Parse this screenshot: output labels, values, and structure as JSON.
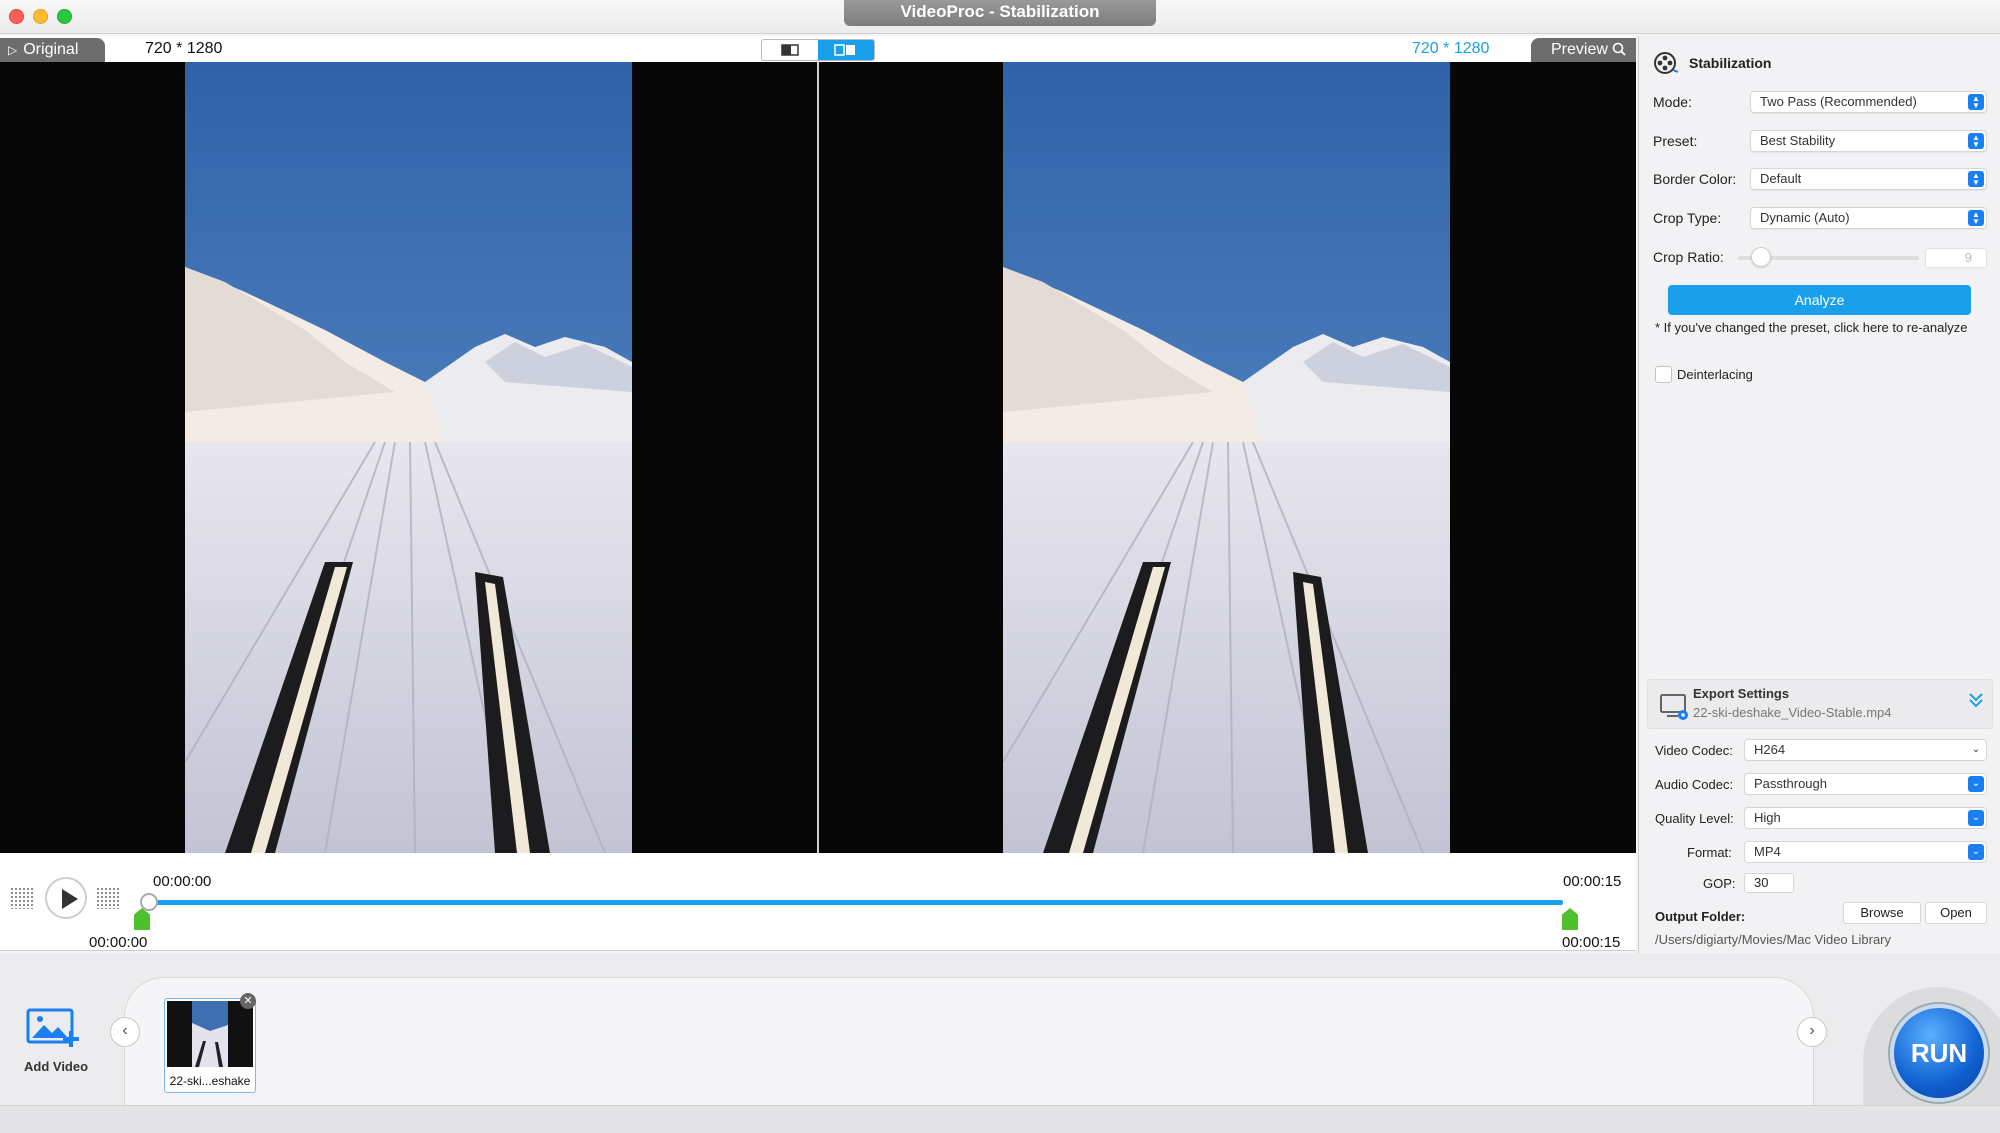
{
  "window": {
    "title": "VideoProc - Stabilization"
  },
  "preview_header": {
    "original_tab": "Original",
    "original_resolution": "720 * 1280",
    "preview_resolution": "720 * 1280",
    "preview_tab": "Preview"
  },
  "timeline": {
    "current_time": "00:00:00",
    "total_time": "00:00:15",
    "trim_start": "00:00:00",
    "trim_end": "00:00:15",
    "progress": 0
  },
  "stabilization": {
    "title": "Stabilization",
    "mode_label": "Mode:",
    "mode_value": "Two Pass (Recommended)",
    "preset_label": "Preset:",
    "preset_value": "Best Stability",
    "border_label": "Border Color:",
    "border_value": "Default",
    "crop_type_label": "Crop Type:",
    "crop_type_value": "Dynamic (Auto)",
    "crop_ratio_label": "Crop Ratio:",
    "crop_ratio_value": "9",
    "analyze_label": "Analyze",
    "reanalyze_note": "* If you've changed the preset, click here to re-analyze",
    "deinterlacing_label": "Deinterlacing",
    "deinterlacing_checked": false
  },
  "export": {
    "title": "Export Settings",
    "filename": "22-ski-deshake_Video-Stable.mp4",
    "video_codec_label": "Video Codec:",
    "video_codec_value": "H264",
    "audio_codec_label": "Audio Codec:",
    "audio_codec_value": "Passthrough",
    "quality_label": "Quality Level:",
    "quality_value": "High",
    "format_label": "Format:",
    "format_value": "MP4",
    "gop_label": "GOP:",
    "gop_value": "30",
    "output_folder_label": "Output Folder:",
    "browse_label": "Browse",
    "open_label": "Open",
    "output_path": "/Users/digiarty/Movies/Mac Video Library"
  },
  "bottom": {
    "add_video_label": "Add Video",
    "thumbnail_label": "22-ski...eshake",
    "run_label": "RUN"
  },
  "colors": {
    "accent": "#1aa0ea",
    "trim_marker": "#4fc12f",
    "tab_gray": "#6d6d6d"
  }
}
